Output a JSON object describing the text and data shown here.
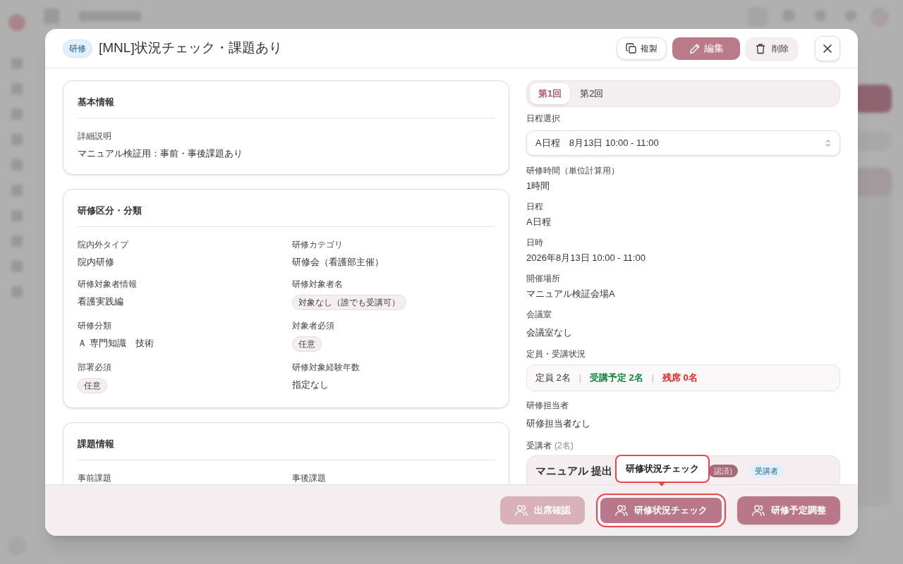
{
  "modal": {
    "tag": "研修",
    "title": "[MNL]状況チェック・課題あり",
    "actions": [
      {
        "kind": "outline",
        "label": "複製"
      },
      {
        "kind": "primary",
        "label": "編集"
      },
      {
        "kind": "soft",
        "label": "削除"
      }
    ]
  },
  "sections": [
    {
      "title": "基本情報",
      "fields": [
        {
          "label": "詳細説明",
          "value": "マニュアル検証用：事前・事後課題あり",
          "kind": "text"
        }
      ]
    },
    {
      "title": "研修区分・分類",
      "fields": [
        {
          "label": "院内外タイプ",
          "value": "院内研修",
          "kind": "text"
        },
        {
          "label": "研修カテゴリ",
          "value": "研修会（看護部主催）",
          "kind": "text"
        },
        {
          "label": "研修対象者情報",
          "value": "看護実践編",
          "kind": "text"
        },
        {
          "label": "研修対象者名",
          "value": "対象なし（誰でも受講可）",
          "kind": "chip"
        },
        {
          "label": "研修分類",
          "value": "Ａ 専門知識　技術",
          "kind": "text"
        },
        {
          "label": "対象者必須",
          "value": "任意",
          "kind": "chip"
        },
        {
          "label": "部署必須",
          "value": "任意",
          "kind": "chip"
        },
        {
          "label": "研修対象経験年数",
          "value": "指定なし",
          "kind": "text"
        }
      ]
    },
    {
      "title": "課題情報",
      "fields": [
        {
          "label": "事前課題",
          "kind": "label"
        },
        {
          "label": "事後課題",
          "kind": "label"
        }
      ]
    }
  ],
  "sessions": {
    "tabs": [
      {
        "label": "第1回",
        "selected": true
      },
      {
        "label": "第2回",
        "selected": false
      }
    ],
    "schedule_label": "日程選択",
    "schedule_value": "A日程　8月13日 10:00 - 11:00",
    "details": [
      {
        "label": "研修時間（単位計算用）",
        "value": "1時間"
      },
      {
        "label": "日程",
        "value": "A日程"
      },
      {
        "label": "日時",
        "value": "2026年8月13日 10:00 - 11:00"
      },
      {
        "label": "開催場所",
        "value": "マニュアル検証会場A"
      },
      {
        "label": "会議室",
        "value": "会議室なし"
      }
    ],
    "capacity_label": "定員・受講状況",
    "capacity_separator": "|",
    "capacity": [
      {
        "text": "定員 2名",
        "color": "#333333"
      },
      {
        "text": "受講予定 2名",
        "color": "#15803d"
      },
      {
        "text": "残席 0名",
        "color": "#dc2626"
      }
    ],
    "manager_label": "研修担当者",
    "manager_value": "研修担当者なし",
    "attendees_label": "受講者",
    "attendees_count": "(2名)",
    "attendee": {
      "name": "マニュアル 提出",
      "status": "認済)",
      "role": "受講者"
    }
  },
  "tooltip": "研修状況チェック",
  "footer_buttons": [
    {
      "label": "出席確認",
      "disabled": true,
      "focused": false
    },
    {
      "label": "研修状況チェック",
      "disabled": false,
      "focused": true
    },
    {
      "label": "研修予定調整",
      "disabled": false,
      "focused": false
    }
  ]
}
